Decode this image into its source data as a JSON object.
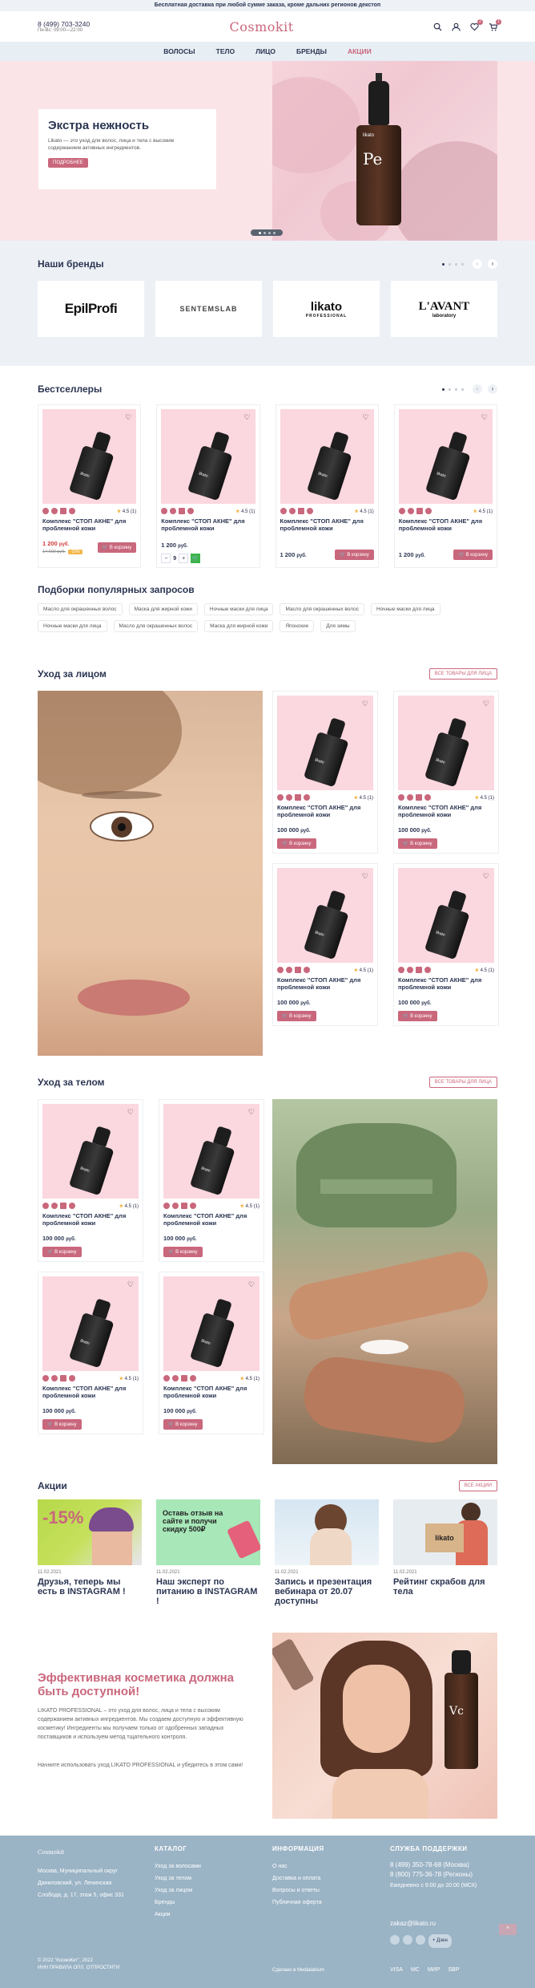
{
  "topbar": {
    "text": "Бесплатная доставка при любой сумме заказа, кроме дальних регионов декстоп"
  },
  "header": {
    "phone": "8 (499) 703-3240",
    "hours": "Пн-Вс: 09:00—22:00",
    "logo": "Cosmokit",
    "fav_count": "2",
    "cart_count": "1"
  },
  "nav": {
    "items": [
      "ВОЛОСЫ",
      "ТЕЛО",
      "ЛИЦО",
      "БРЕНДЫ",
      "АКЦИИ"
    ]
  },
  "hero": {
    "title": "Экстра нежность",
    "text": "Likato — это уход для волос, лица и тела с высоким содержанием активных ингредиентов.",
    "button": "ПОДРОБНЕЕ",
    "bottle_label": "Pe",
    "bottle_brand": "likato"
  },
  "brands": {
    "title": "Наши бренды",
    "items": [
      "EpilProfi",
      "SENTEMSLAB",
      "likato",
      "L'AVANT"
    ],
    "subs": [
      "",
      "",
      "PROFESSIONAL",
      "laboratory"
    ]
  },
  "bestsellers": {
    "title": "Бестселлеры",
    "products": [
      {
        "name": "Комплекс \"СТОП АКНЕ\" для проблемной кожи",
        "rating": "4.5",
        "reviews": "(1)",
        "price": "1 200",
        "currency": "руб.",
        "old_price": "14 000 руб.",
        "discount": "-10%",
        "button": "В корзину"
      },
      {
        "name": "Комплекс \"СТОП АКНЕ\" для проблемной кожи",
        "rating": "4.5",
        "reviews": "(1)",
        "price": "1 200",
        "currency": "руб.",
        "qty": "9",
        "button": "В корзину"
      },
      {
        "name": "Комплекс \"СТОП АКНЕ\" для проблемной кожи",
        "rating": "4.5",
        "reviews": "(1)",
        "price": "1 200",
        "currency": "руб.",
        "button": "В корзину"
      },
      {
        "name": "Комплекс \"СТОП АКНЕ\" для проблемной кожи",
        "rating": "4.5",
        "reviews": "(1)",
        "price": "1 200",
        "currency": "руб.",
        "button": "В корзину"
      }
    ]
  },
  "popular": {
    "title": "Подборки популярных запросов",
    "chips": [
      "Масло для окрашенных волос",
      "Маска для жирной кожи",
      "Ночные маски для лица",
      "Масло для окрашенных волос",
      "Ночные маски для лица",
      "Ночные маски для лица",
      "Масло для окрашенных волос",
      "Маска для жирной кожи",
      "Японские",
      "Для зимы"
    ]
  },
  "face": {
    "title": "Уход за лицом",
    "all": "ВСЕ ТОВАРЫ ДЛЯ ЛИЦА",
    "product": {
      "name": "Комплекс \"СТОП АКНЕ\" для проблемной кожи",
      "rating": "4.5",
      "reviews": "(1)",
      "price": "100 000",
      "currency": "руб.",
      "button": "В корзину"
    }
  },
  "body": {
    "title": "Уход за телом",
    "all": "ВСЕ ТОВАРЫ ДЛЯ ЛИЦА"
  },
  "promos": {
    "title": "Акции",
    "all": "ВСЕ АКЦИИ",
    "items": [
      {
        "date": "11.02.2021",
        "title": "Друзья, теперь мы есть в INSTAGRAM !",
        "img_text": "-15%"
      },
      {
        "date": "11.02.2021",
        "title": "Наш эксперт по питанию в INSTAGRAM !",
        "img_text": "Оставь отзыв на сайте и получи скидку 500₽"
      },
      {
        "date": "11.02.2021",
        "title": "Запись и презентация вебинара от 20.07 доступны",
        "img_text": ""
      },
      {
        "date": "11.02.2021",
        "title": "Рейтинг скрабов для тела",
        "img_text": "likato"
      }
    ]
  },
  "cta": {
    "title": "Эффективная косметика должна быть доступной!",
    "p1": "LIKATO PROFESSIONAL – это уход для волос, лица и тела с высоким содержанием активных ингредиентов. Мы создаем доступную и эффективную косметику! Ингредиенты мы получаем только от одобренных западных поставщиков и используем метод тщательного контроля.",
    "p2": "Начните использовать уход LIKATO PROFESSIONAL и убедитесь в этом сами!"
  },
  "footer": {
    "logo": "Cosmokit",
    "address": "Москва, Муниципальный округ Даниловский, ул. Ленинская Слобода, д. 17, этаж 5, офис 331",
    "catalog_title": "КАТАЛОГ",
    "catalog": [
      "Уход за волосами",
      "Уход за телом",
      "Уход за лицом",
      "Бренды",
      "Акции"
    ],
    "info_title": "ИНФОРМАЦИЯ",
    "info": [
      "О нас",
      "Доставка и оплата",
      "Вопросы и ответы",
      "Публичная оферта"
    ],
    "support_title": "СЛУЖБА ПОДДЕРЖКИ",
    "phone1": "8 (499) 350-78-68 (Москва)",
    "phone2": "8 (800) 775-36-78 (Регионы)",
    "hours": "Ежедневно с 9:00 до 20:00 (МСК)",
    "email": "zakaz@likato.ru",
    "chat": "+ Дзен",
    "copyright": "© 2022 \"КосмоКит\", 2022",
    "policy": "ИНН ПРАВИЛА ОПЛ. ОТПРОСТИТИ",
    "dev": "Сделано в Medialabium",
    "payments": [
      "VISA",
      "MC",
      "МИР",
      "SBP"
    ]
  }
}
